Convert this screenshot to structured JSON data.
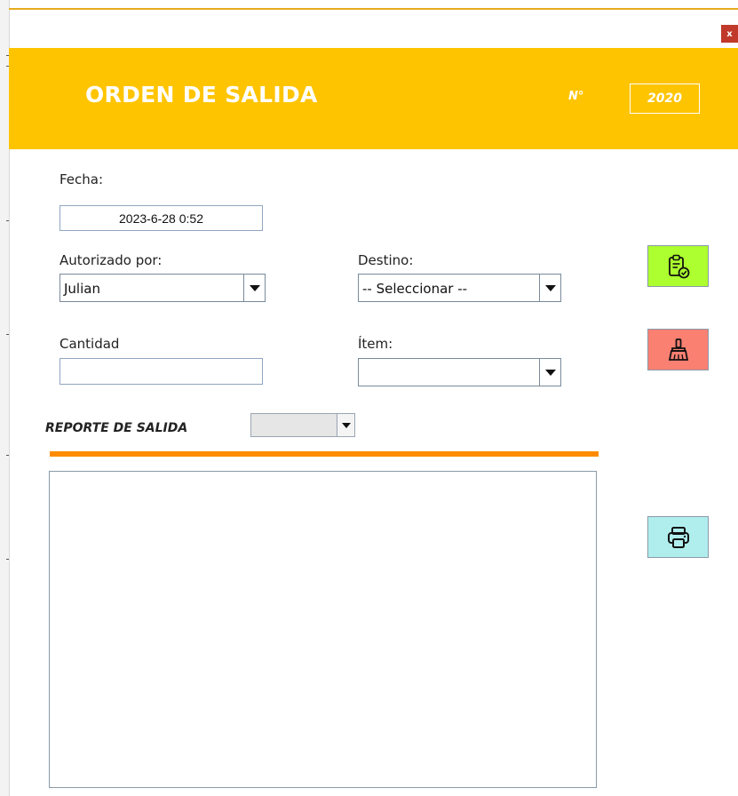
{
  "window": {
    "close_label": "x"
  },
  "header": {
    "title": "ORDEN DE SALIDA",
    "number_label": "N°",
    "number_value": "2020",
    "color": "#ffc400"
  },
  "form": {
    "fecha_label": "Fecha:",
    "fecha_value": "2023-6-28 0:52",
    "autorizado_label": "Autorizado por:",
    "autorizado_value": "Julian",
    "destino_label": "Destino:",
    "destino_value": "-- Seleccionar --",
    "cantidad_label": "Cantidad",
    "cantidad_value": "",
    "item_label": "Ítem:",
    "item_value": ""
  },
  "report": {
    "label": "REPORTE DE SALIDA",
    "selector_value": "",
    "rule_color": "#ff8c00"
  },
  "buttons": {
    "register": {
      "icon": "clipboard-check-icon",
      "color": "#adff2f"
    },
    "clear": {
      "icon": "broom-icon",
      "color": "#fa8072"
    },
    "print": {
      "icon": "printer-icon",
      "color": "#b0eeee"
    }
  }
}
